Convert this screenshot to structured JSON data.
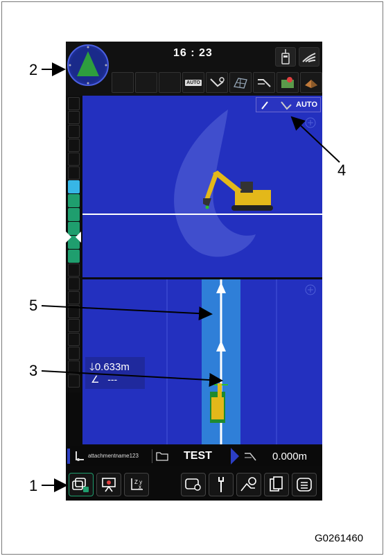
{
  "screen": {
    "time": "16 : 23",
    "auto_label": "AUTO",
    "toolbar_auto": "AUTO",
    "depth": "0.633m",
    "angle": "---",
    "attachment_name": "attachmentname123",
    "project": "TEST",
    "distance": "0.000m"
  },
  "callouts": {
    "c1": "1",
    "c2": "2",
    "c3": "3",
    "c4": "4",
    "c5": "5"
  },
  "figure_code": "G0261460",
  "colors": {
    "view_bg": "#2330bf",
    "guide_lane": "#2f7fd8",
    "accent_green": "#1f9e6e",
    "accent_cyan": "#37b6e6"
  }
}
